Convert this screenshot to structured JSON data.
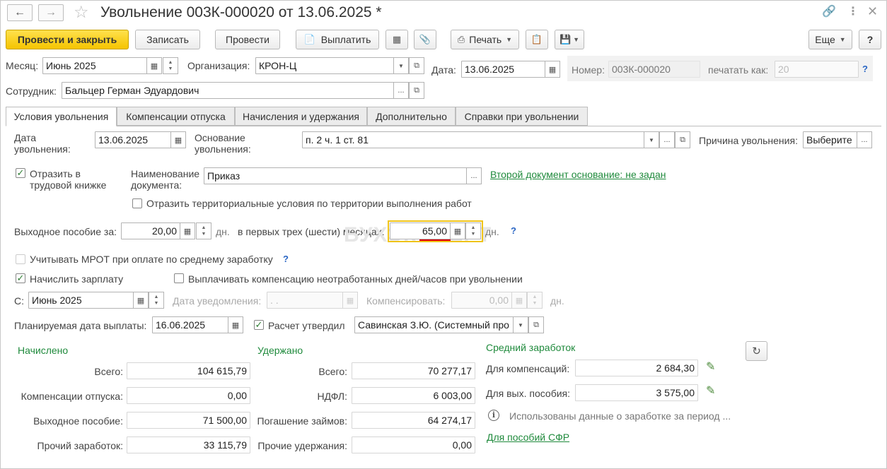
{
  "window": {
    "title": "Увольнение 003К-000020 от 13.06.2025 *"
  },
  "toolbar": {
    "post_close": "Провести и закрыть",
    "save": "Записать",
    "post": "Провести",
    "pay": "Выплатить",
    "print": "Печать",
    "more": "Еще",
    "help": "?"
  },
  "header": {
    "month_label": "Месяц:",
    "month_value": "Июнь 2025",
    "org_label": "Организация:",
    "org_value": "КРОН-Ц",
    "date_label": "Дата:",
    "date_value": "13.06.2025",
    "number_label": "Номер:",
    "number_value": "003К-000020",
    "print_as_label": "печатать как:",
    "print_as_value": "20",
    "employee_label": "Сотрудник:",
    "employee_value": "Бальцер Герман Эдуардович"
  },
  "tabs": [
    {
      "label": "Условия увольнения"
    },
    {
      "label": "Компенсации отпуска"
    },
    {
      "label": "Начисления и удержания"
    },
    {
      "label": "Дополнительно"
    },
    {
      "label": "Справки при увольнении"
    }
  ],
  "conditions": {
    "dismissal_date_label": "Дата\nувольнения:",
    "dismissal_date_line1": "Дата",
    "dismissal_date_line2": "увольнения:",
    "dismissal_date": "13.06.2025",
    "basis_line1": "Основание",
    "basis_line2": "увольнения:",
    "basis_value": "п. 2 ч. 1 ст. 81",
    "reason_label": "Причина увольнения:",
    "reason_value": "Выберите",
    "workbook_line1": "Отразить в",
    "workbook_line2": "трудовой книжке",
    "doc_name_line1": "Наименование",
    "doc_name_line2": "документа:",
    "doc_name_value": "Приказ",
    "second_doc_link": "Второй документ основание: не задан",
    "territorial_label": "Отразить территориальные условия по территории выполнения работ",
    "severance_label": "Выходное пособие за:",
    "severance_days": "20,00",
    "days_unit": "дн.",
    "first_months_label": "в первых трех (шести) месяцах:",
    "first_months_value": "65,00",
    "mrot_label": "Учитывать МРОТ при оплате по среднему заработку",
    "accrue_salary_label": "Начислить зарплату",
    "pay_compensation_label": "Выплачивать компенсацию неотработанных дней/часов при увольнении",
    "from_label": "С:",
    "from_value": "Июнь 2025",
    "notice_date_label": "Дата уведомления:",
    "notice_date_value": " .  .",
    "compensate_label": "Компенсировать:",
    "compensate_value": "0,00",
    "planned_pay_label": "Планируемая дата выплаты:",
    "planned_pay_value": "16.06.2025",
    "calc_approved_label": "Расчет утвердил",
    "calc_approved_value": "Савинская З.Ю. (Системный про"
  },
  "accrued": {
    "title": "Начислено",
    "rows": [
      {
        "label": "Всего:",
        "value": "104 615,79"
      },
      {
        "label": "Компенсации отпуска:",
        "value": "0,00"
      },
      {
        "label": "Выходное пособие:",
        "value": "71 500,00"
      },
      {
        "label": "Прочий заработок:",
        "value": "33 115,79"
      }
    ]
  },
  "withheld": {
    "title": "Удержано",
    "rows": [
      {
        "label": "Всего:",
        "value": "70 277,17"
      },
      {
        "label": "НДФЛ:",
        "value": "6 003,00"
      },
      {
        "label": "Погашение займов:",
        "value": "64 274,17"
      },
      {
        "label": "Прочие удержания:",
        "value": "0,00"
      }
    ]
  },
  "average": {
    "title": "Средний заработок",
    "comp_label": "Для компенсаций:",
    "comp_value": "2 684,30",
    "severance_label": "Для вых. пособия:",
    "severance_value": "3 575,00",
    "info": "Использованы данные о заработке за период ...",
    "sfr_link": "Для пособий СФР"
  },
  "watermark": "БУХЭКСПЕРТ",
  "colors": {
    "primary_button": "#f5c400",
    "link_green": "#1f8a3c",
    "focus_border": "#f0c419",
    "error_underline": "#e00000"
  }
}
